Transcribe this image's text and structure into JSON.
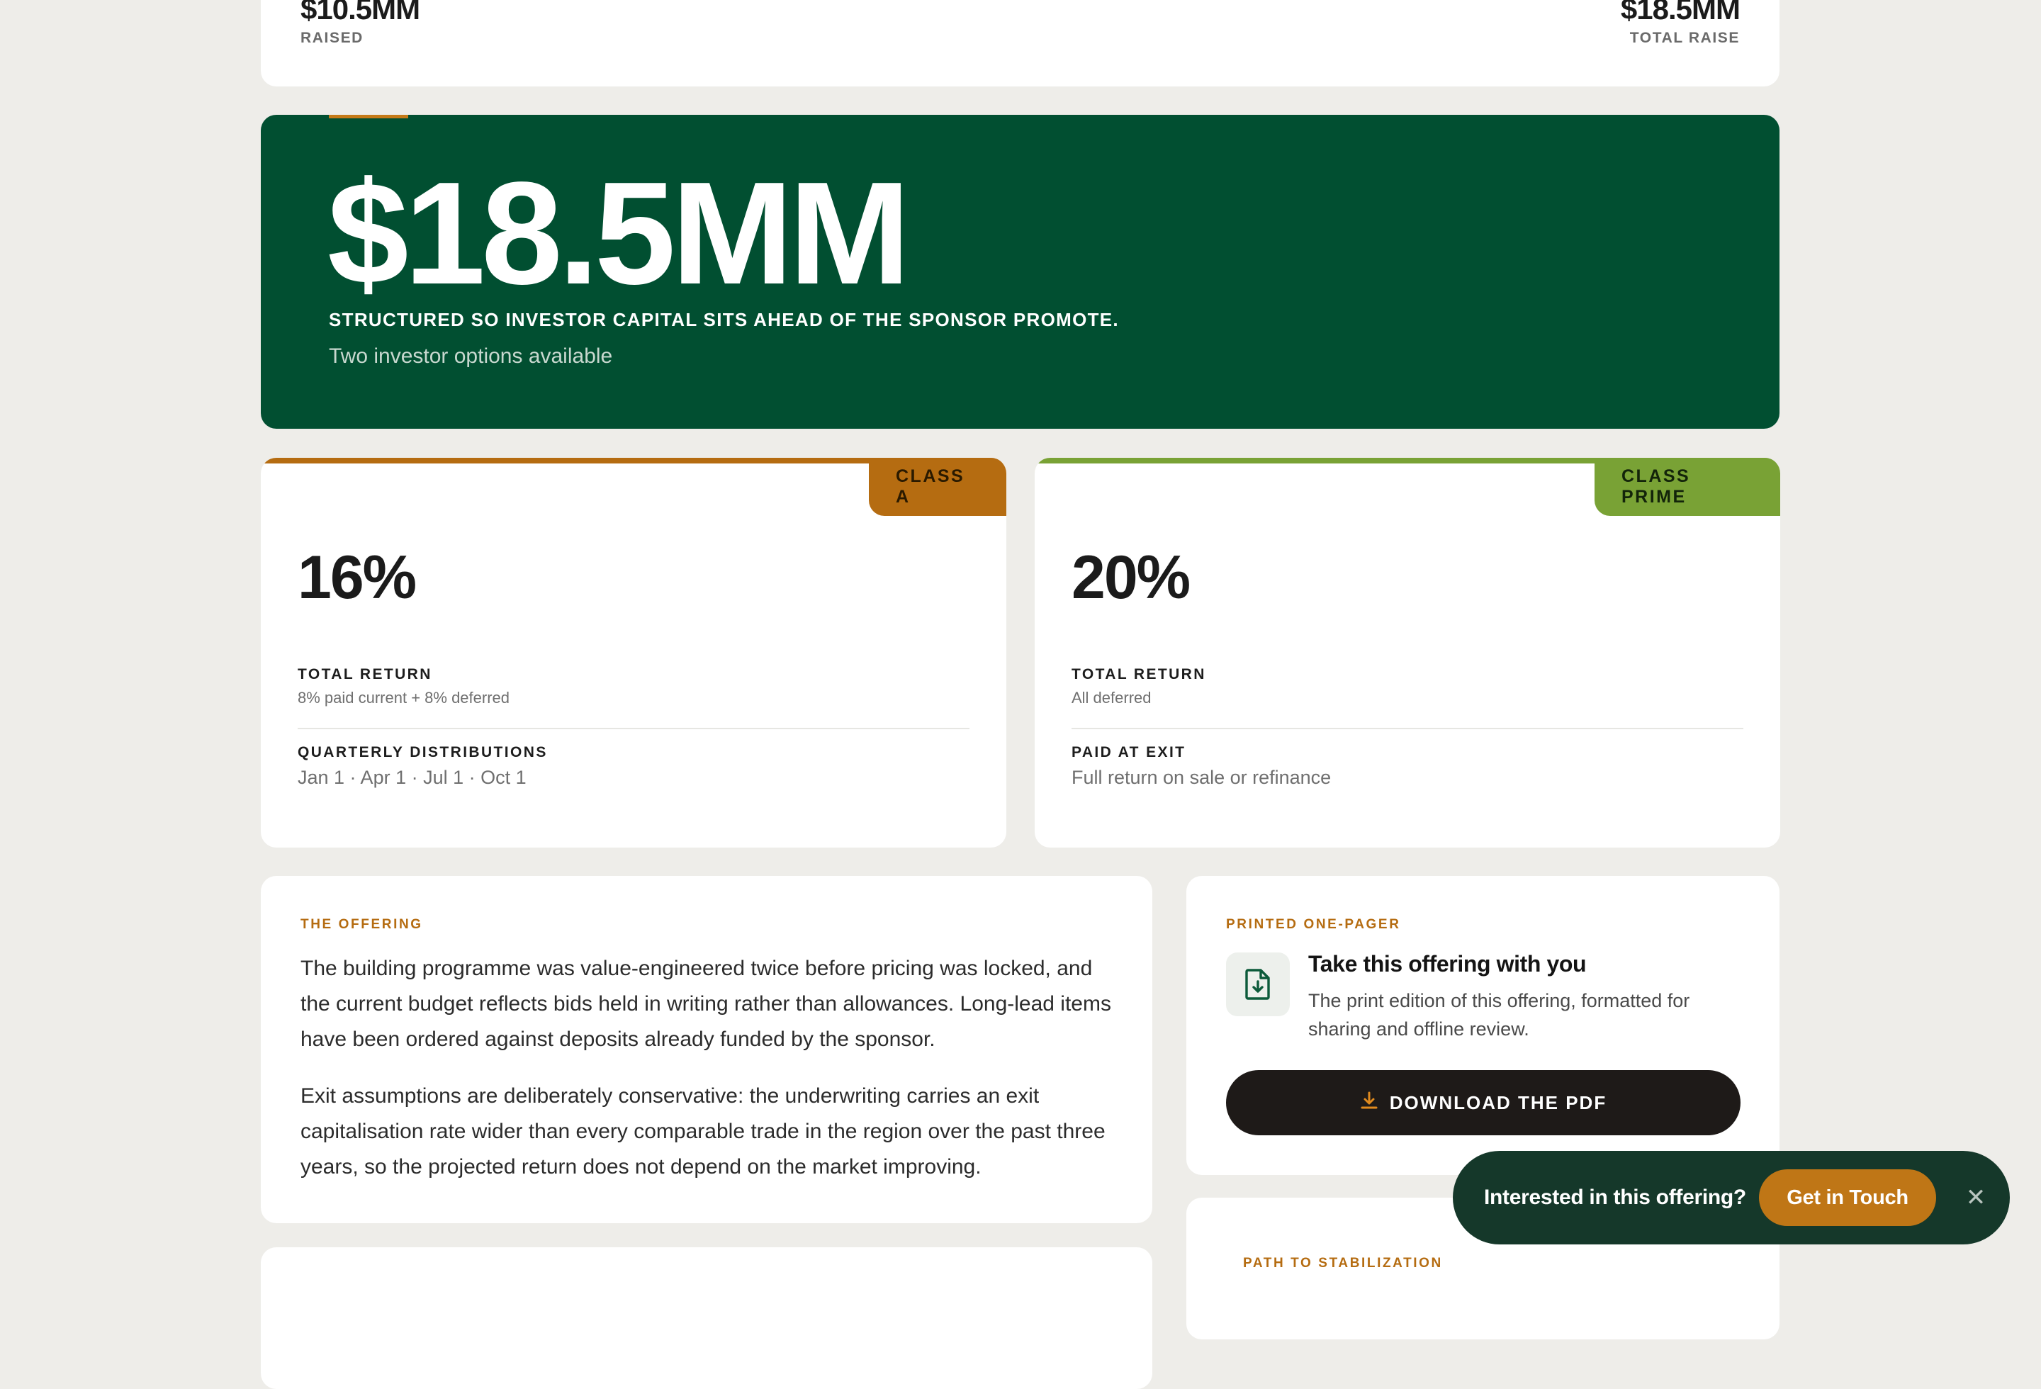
{
  "raise_summary": {
    "raised_value": "$10.5MM",
    "raised_label": "RAISED",
    "total_value": "$18.5MM",
    "total_label": "TOTAL RAISE"
  },
  "hero": {
    "amount": "$18.5MM",
    "tagline": "STRUCTURED SO INVESTOR CAPITAL SITS AHEAD OF THE SPONSOR PROMOTE.",
    "subtitle": "Two investor options available"
  },
  "classes": [
    {
      "tag": "CLASS A",
      "return_pct": "16%",
      "row1_title": "TOTAL RETURN",
      "row1_sub": "8% paid current + 8% deferred",
      "row2_title": "QUARTERLY DISTRIBUTIONS",
      "row2_sub": "Jan 1 · Apr 1 · Jul 1 · Oct 1"
    },
    {
      "tag": "CLASS PRIME",
      "return_pct": "20%",
      "row1_title": "TOTAL RETURN",
      "row1_sub": "All deferred",
      "row2_title": "PAID AT EXIT",
      "row2_sub": "Full return on sale or refinance"
    }
  ],
  "offering": {
    "eyebrow": "THE OFFERING",
    "paragraph_1": "The building programme was value-engineered twice before pricing was locked, and the current budget reflects bids held in writing rather than allowances. Long-lead items have been ordered against deposits already funded by the sponsor.",
    "paragraph_2": "Exit assumptions are deliberately conservative: the underwriting carries an exit capitalisation rate wider than every comparable trade in the region over the past three years, so the projected return does not depend on the market improving."
  },
  "one_pager": {
    "eyebrow": "PRINTED ONE-PAGER",
    "title": "Take this offering with you",
    "description": "The print edition of this offering, formatted for sharing and offline review.",
    "button_label": "DOWNLOAD THE PDF",
    "icon": "file-download-icon"
  },
  "path": {
    "eyebrow": "PATH TO STABILIZATION"
  },
  "cta": {
    "text": "Interested in this offering?",
    "button_label": "Get in Touch",
    "close_icon": "close-icon"
  },
  "colors": {
    "background": "#eeede9",
    "hero_green": "#014f31",
    "class_a_accent": "#b56c11",
    "class_prime_accent": "#79a235",
    "cta_bg": "#15382a",
    "cta_button": "#bf7616"
  }
}
